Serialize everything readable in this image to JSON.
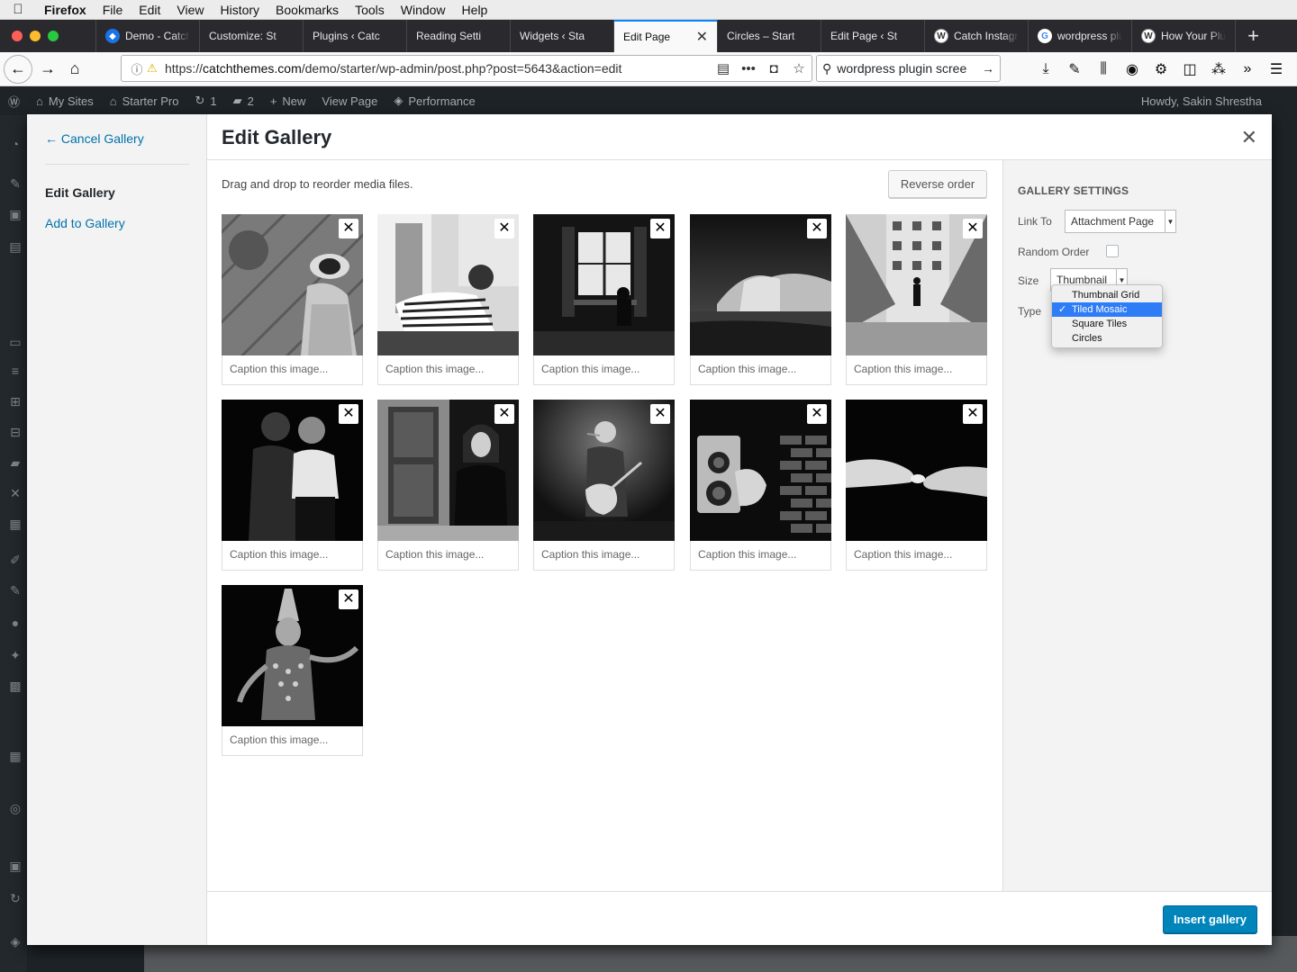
{
  "menubar": {
    "app": "Firefox",
    "items": [
      "File",
      "Edit",
      "View",
      "History",
      "Bookmarks",
      "Tools",
      "Window",
      "Help"
    ]
  },
  "tabs": [
    {
      "label": "Demo - Catch",
      "icon": "catch-icon"
    },
    {
      "label": "Customize: St",
      "icon": ""
    },
    {
      "label": "Plugins ‹ Catc",
      "icon": ""
    },
    {
      "label": "Reading Setti",
      "icon": ""
    },
    {
      "label": "Widgets ‹ Sta",
      "icon": ""
    },
    {
      "label": "Edit Page",
      "icon": "",
      "active": true
    },
    {
      "label": "Circles – Start",
      "icon": ""
    },
    {
      "label": "Edit Page ‹ St",
      "icon": ""
    },
    {
      "label": "Catch Instagr",
      "icon": "wordpress-icon"
    },
    {
      "label": "wordpress plu",
      "icon": "google-icon"
    },
    {
      "label": "How Your Plu",
      "icon": "wordpress-icon"
    }
  ],
  "url": {
    "prefix": "https://",
    "domain": "catchthemes.com",
    "path": "/demo/starter/wp-admin/post.php?post=5643&action=edit"
  },
  "search": {
    "value": "wordpress plugin scree"
  },
  "adminbar": {
    "my_sites": "My Sites",
    "site": "Starter Pro",
    "updates": "1",
    "comments": "2",
    "new": "New",
    "view_page": "View Page",
    "performance": "Performance",
    "howdy": "Howdy, Sakin Shrestha"
  },
  "modal": {
    "cancel": "← Cancel Gallery",
    "menu_edit": "Edit Gallery",
    "menu_add": "Add to Gallery",
    "title": "Edit Gallery",
    "hint": "Drag and drop to reorder media files.",
    "reverse": "Reverse order",
    "caption_placeholder": "Caption this image...",
    "insert": "Insert gallery"
  },
  "settings": {
    "heading": "GALLERY SETTINGS",
    "link_to_label": "Link To",
    "link_to_value": "Attachment Page",
    "random_label": "Random Order",
    "size_label": "Size",
    "size_value": "Thumbnail",
    "type_label": "Type",
    "type_options": [
      "Thumbnail Grid",
      "Tiled Mosaic",
      "Square Tiles",
      "Circles"
    ],
    "type_selected": "Tiled Mosaic"
  },
  "images": [
    {
      "name": "woman-hat-tiles"
    },
    {
      "name": "woman-striped-shirt"
    },
    {
      "name": "dark-window-room"
    },
    {
      "name": "sea-cliff"
    },
    {
      "name": "man-walking-architecture"
    },
    {
      "name": "two-women-profile"
    },
    {
      "name": "woman-doorway"
    },
    {
      "name": "singer-guitar"
    },
    {
      "name": "vintage-camera-hands"
    },
    {
      "name": "holding-hands"
    },
    {
      "name": "thai-dancer"
    }
  ]
}
